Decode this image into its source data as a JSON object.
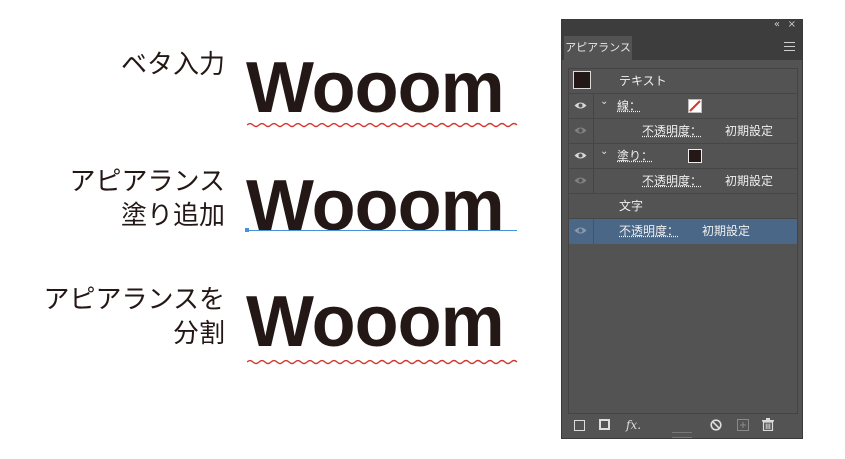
{
  "examples": [
    {
      "label_lines": [
        "ベタ入力"
      ],
      "word": "Wooom"
    },
    {
      "label_lines": [
        "アピアランス",
        "塗り追加"
      ],
      "word": "Wooom"
    },
    {
      "label_lines": [
        "アピアランスを",
        "分割"
      ],
      "word": "Wooom"
    }
  ],
  "panel": {
    "collapse_glyph": "«",
    "close_glyph": "×",
    "tab_label": "アピアランス",
    "rows": {
      "text_label": "テキスト",
      "stroke_label": "線：",
      "stroke_opacity_label": "不透明度：",
      "stroke_opacity_value": "初期設定",
      "fill_label": "塗り：",
      "fill_opacity_label": "不透明度：",
      "fill_opacity_value": "初期設定",
      "characters_label": "文字",
      "opacity_label": "不透明度：",
      "opacity_value": "初期設定"
    },
    "footer": {
      "fx_label": "fx."
    }
  },
  "colors": {
    "text": "#231815",
    "squiggle": "#d2392f",
    "selection": "#4b6787",
    "panel_bg": "#535353"
  }
}
